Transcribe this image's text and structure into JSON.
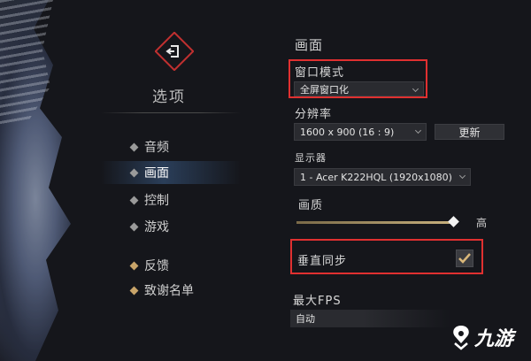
{
  "sidebar": {
    "title": "选项",
    "items": [
      {
        "label": "音频",
        "active": false,
        "style": "grey"
      },
      {
        "label": "画面",
        "active": true,
        "style": "grey"
      },
      {
        "label": "控制",
        "active": false,
        "style": "grey"
      },
      {
        "label": "游戏",
        "active": false,
        "style": "grey"
      },
      {
        "label": "反馈",
        "active": false,
        "style": "gold"
      },
      {
        "label": "致谢名单",
        "active": false,
        "style": "gold"
      }
    ]
  },
  "panel": {
    "heading": "画面",
    "window_mode": {
      "label": "窗口模式",
      "value": "全屏窗口化"
    },
    "resolution": {
      "label": "分辨率",
      "value": "1600 x 900 (16 : 9)",
      "apply_label": "更新"
    },
    "display": {
      "label": "显示器",
      "value": "1 - Acer K222HQL (1920x1080)"
    },
    "quality": {
      "label": "画质",
      "value_label": "高",
      "level": 1.0
    },
    "vsync": {
      "label": "垂直同步",
      "checked": true
    },
    "fps": {
      "label": "最大FPS",
      "value": "自动"
    }
  },
  "watermark": {
    "text": "九游"
  },
  "colors": {
    "accent_gold": "#c8a469",
    "highlight_red": "#e03030",
    "active_blue": "#3c5f8c"
  },
  "icons": {
    "logo": "exit-door-icon",
    "checkmark": "checkmark-icon",
    "watermark": "jiuyou-logo-icon"
  }
}
